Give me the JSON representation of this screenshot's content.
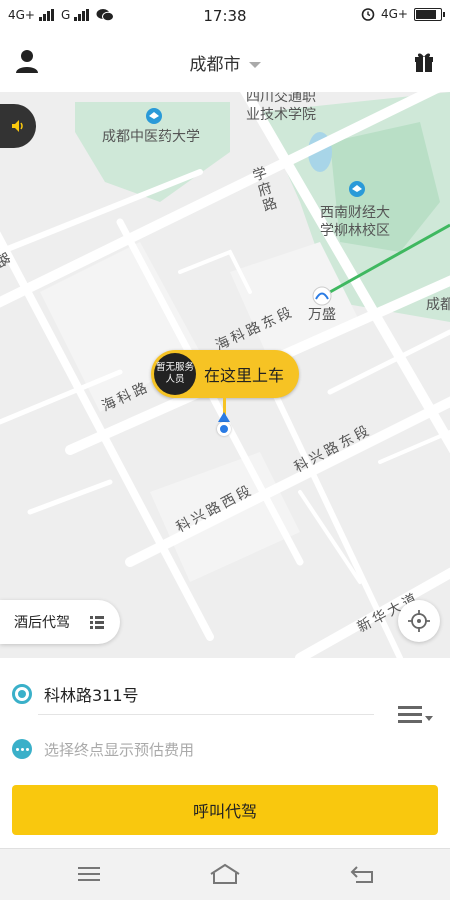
{
  "status_bar": {
    "network_1": "4G+",
    "network_2": "G",
    "time": "17:38",
    "network_3": "4G+",
    "battery_level": 0.85
  },
  "header": {
    "city": "成都市",
    "profile_icon": "person-icon",
    "gift_icon": "gift-icon"
  },
  "map": {
    "labels": {
      "school_1_line1": "四川交通职",
      "school_1_line2": "业技术学院",
      "tcm_university": "成都中医药大学",
      "xuefu_road": "学府路",
      "swufe_line1": "西南财经大",
      "swufe_line2": "学柳林校区",
      "left_edge_road": "路",
      "wansheng": "万盛",
      "right_edge": "成都",
      "haike_road_east": "海科路东段",
      "haike_road": "海科路",
      "kexing_road_east": "科兴路东段",
      "kexing_road_west": "科兴路西段",
      "xinhua_avenue": "新华大道"
    },
    "pin": {
      "status": "暂无服务人员",
      "text": "在这里上车"
    },
    "service_tab": "酒后代驾",
    "colors": {
      "accent": "#f9c80e",
      "location_blue": "#2a7be4",
      "green_area": "#cfe8d8",
      "teal": "#3ab0c9"
    }
  },
  "panel": {
    "start_address": "科林路311号",
    "destination_placeholder": "选择终点显示预估费用",
    "call_button": "呼叫代驾"
  },
  "navbar": {
    "menu_icon": "menu-icon",
    "home_icon": "home-icon",
    "back_icon": "back-icon"
  }
}
